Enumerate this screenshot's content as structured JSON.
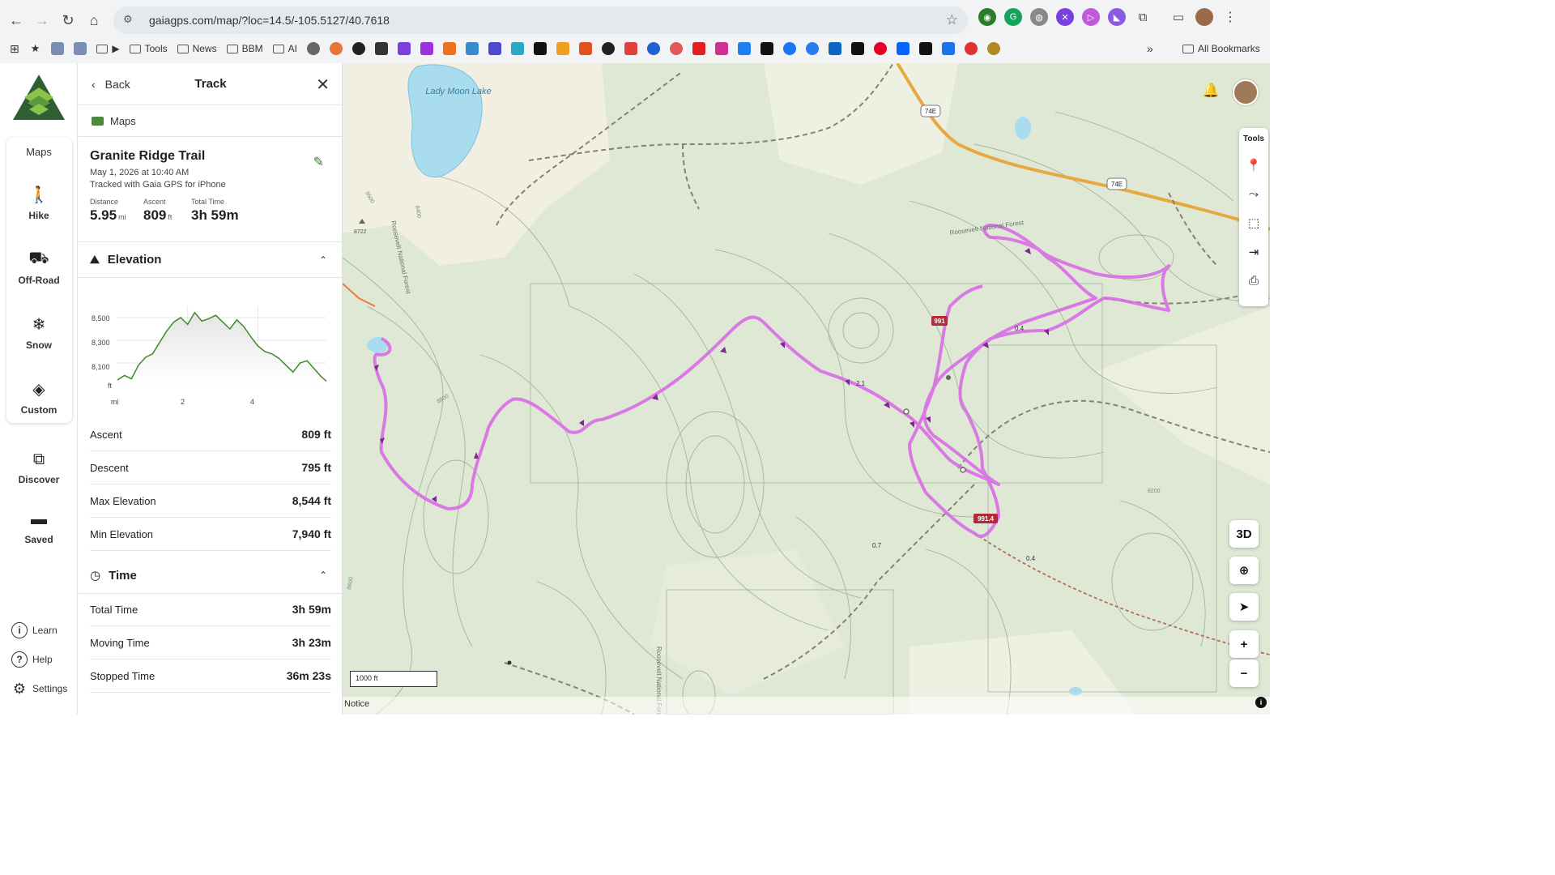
{
  "browser": {
    "url": "gaiagps.com/map/?loc=14.5/-105.5127/40.7618",
    "bookmarks": [
      "Tools",
      "News",
      "BBM",
      "AI"
    ],
    "all_bookmarks_label": "All Bookmarks"
  },
  "rail": {
    "modes_title": "Maps",
    "items": [
      {
        "label": "Hike",
        "icon": "hiker-icon"
      },
      {
        "label": "Off-Road",
        "icon": "jeep-icon"
      },
      {
        "label": "Snow",
        "icon": "snowflake-icon"
      },
      {
        "label": "Custom",
        "icon": "layers-icon"
      }
    ],
    "discover_label": "Discover",
    "saved_label": "Saved",
    "footer": [
      {
        "label": "Learn",
        "icon": "info-icon"
      },
      {
        "label": "Help",
        "icon": "help-icon"
      },
      {
        "label": "Settings",
        "icon": "gear-icon"
      }
    ]
  },
  "panel": {
    "back_label": "Back",
    "title": "Track",
    "breadcrumb": "Maps",
    "track": {
      "name": "Granite Ridge Trail",
      "date": "May 1, 2026 at 10:40 AM",
      "source": "Tracked with Gaia GPS for iPhone",
      "stats": [
        {
          "label": "Distance",
          "value": "5.95",
          "unit": "mi"
        },
        {
          "label": "Ascent",
          "value": "809",
          "unit": "ft"
        },
        {
          "label": "Total Time",
          "value": "3h 59m",
          "unit": ""
        }
      ]
    },
    "elevation": {
      "heading": "Elevation",
      "rows": [
        {
          "label": "Ascent",
          "value": "809 ft"
        },
        {
          "label": "Descent",
          "value": "795 ft"
        },
        {
          "label": "Max Elevation",
          "value": "8,544 ft"
        },
        {
          "label": "Min Elevation",
          "value": "7,940 ft"
        }
      ]
    },
    "time": {
      "heading": "Time",
      "rows": [
        {
          "label": "Total Time",
          "value": "3h 59m"
        },
        {
          "label": "Moving Time",
          "value": "3h 23m"
        },
        {
          "label": "Stopped Time",
          "value": "36m 23s"
        }
      ]
    }
  },
  "chart_data": {
    "type": "line",
    "title": "",
    "xlabel": "mi",
    "ylabel": "ft",
    "y_ticks": [
      "8,500",
      "8,300",
      "8,100"
    ],
    "x_ticks": [
      "2",
      "4"
    ],
    "xlim": [
      0,
      5.95
    ],
    "ylim": [
      7900,
      8600
    ],
    "series": [
      {
        "color": "#3f8a2a",
        "x": [
          0,
          0.2,
          0.4,
          0.6,
          0.8,
          1.0,
          1.2,
          1.4,
          1.6,
          1.8,
          2.0,
          2.2,
          2.4,
          2.6,
          2.8,
          3.0,
          3.2,
          3.4,
          3.6,
          3.8,
          4.0,
          4.2,
          4.4,
          4.6,
          4.8,
          5.0,
          5.2,
          5.4,
          5.6,
          5.8,
          5.95
        ],
        "y": [
          7950,
          7990,
          7960,
          8080,
          8150,
          8180,
          8280,
          8380,
          8460,
          8500,
          8440,
          8544,
          8470,
          8490,
          8520,
          8460,
          8400,
          8480,
          8420,
          8330,
          8250,
          8200,
          8180,
          8140,
          8080,
          8020,
          8100,
          8120,
          8050,
          7980,
          7940
        ]
      }
    ]
  },
  "map": {
    "labels": {
      "lake": "Lady Moon Lake",
      "forest_1": "Roosevelt National Forest",
      "forest_2": "Roosevelt National Forest",
      "forest_3": "Roosevelt National Forest",
      "road_1": "74E",
      "road_2": "74E",
      "trail_1": "991",
      "trail_2": "991.4",
      "dist_1": "0.4",
      "dist_2": "2.1",
      "dist_3": "0.7",
      "dist_4": "0.4",
      "contour_1": "8600",
      "contour_2": "8400",
      "contour_3": "8800",
      "contour_4": "8200",
      "contour_5": "8600",
      "peak": "8722"
    },
    "tools_label": "Tools",
    "btn_3d": "3D",
    "scale": "1000 ft",
    "notice": "Notice",
    "track_color": "#d86ee6"
  }
}
